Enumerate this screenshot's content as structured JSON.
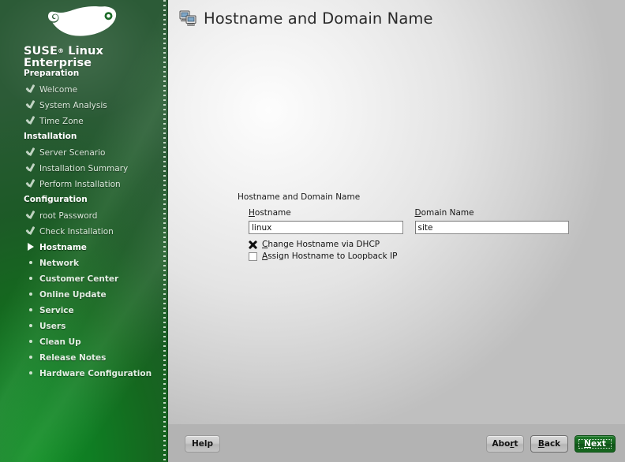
{
  "window": {
    "title": "Hostname and Domain Name",
    "title_icon": "network-computers-icon"
  },
  "sidebar": {
    "brand_line1": "SUSE",
    "brand_reg": "®",
    "brand_line1b": " Linux",
    "brand_line2": "Enterprise",
    "logo_icon": "suse-chameleon-logo",
    "sections": [
      {
        "heading": "Preparation",
        "items": [
          {
            "label": "Welcome",
            "state": "done",
            "marker": "check-icon"
          },
          {
            "label": "System Analysis",
            "state": "done",
            "marker": "check-icon"
          },
          {
            "label": "Time Zone",
            "state": "done",
            "marker": "check-icon"
          }
        ]
      },
      {
        "heading": "Installation",
        "items": [
          {
            "label": "Server Scenario",
            "state": "done",
            "marker": "check-icon"
          },
          {
            "label": "Installation Summary",
            "state": "done",
            "marker": "check-icon"
          },
          {
            "label": "Perform Installation",
            "state": "done",
            "marker": "check-icon"
          }
        ]
      },
      {
        "heading": "Configuration",
        "items": [
          {
            "label": "root Password",
            "state": "done",
            "marker": "check-icon"
          },
          {
            "label": "Check Installation",
            "state": "done",
            "marker": "check-icon"
          },
          {
            "label": "Hostname",
            "state": "current",
            "marker": "triangle-right-icon"
          },
          {
            "label": "Network",
            "state": "todo",
            "marker": "bullet-icon"
          },
          {
            "label": "Customer Center",
            "state": "todo",
            "marker": "bullet-icon"
          },
          {
            "label": "Online Update",
            "state": "todo",
            "marker": "bullet-icon"
          },
          {
            "label": "Service",
            "state": "todo",
            "marker": "bullet-icon"
          },
          {
            "label": "Users",
            "state": "todo",
            "marker": "bullet-icon"
          },
          {
            "label": "Clean Up",
            "state": "todo",
            "marker": "bullet-icon"
          },
          {
            "label": "Release Notes",
            "state": "todo",
            "marker": "bullet-icon"
          },
          {
            "label": "Hardware Configuration",
            "state": "todo",
            "marker": "bullet-icon"
          }
        ]
      }
    ]
  },
  "form": {
    "group_label": "Hostname and Domain Name",
    "hostname": {
      "label_accesskey": "H",
      "label_rest": "ostname",
      "value": "linux",
      "placeholder": ""
    },
    "domain": {
      "label_accesskey": "D",
      "label_rest": "omain Name",
      "value": "site",
      "placeholder": ""
    },
    "checkboxes": [
      {
        "accesskey": "C",
        "label_rest": "hange Hostname via DHCP",
        "checked": true,
        "state_icon": "checkbox-checked-icon"
      },
      {
        "accesskey": "A",
        "label_rest": "ssign Hostname to Loopback IP",
        "checked": false,
        "state_icon": "checkbox-unchecked-icon"
      }
    ]
  },
  "buttons": {
    "help": {
      "label": "Help",
      "accesskey": ""
    },
    "abort": {
      "label_pre": "Abo",
      "accesskey": "r",
      "label_post": "t"
    },
    "back": {
      "accesskey": "B",
      "label_rest": "ack"
    },
    "next": {
      "accesskey": "N",
      "label_rest": "ext",
      "is_default": true
    }
  },
  "colors": {
    "brand_green": "#0f7d23",
    "next_button_green": "#16641f",
    "panel_gray": "#e4e4e4",
    "button_bar_gray": "#b3b3b3"
  }
}
